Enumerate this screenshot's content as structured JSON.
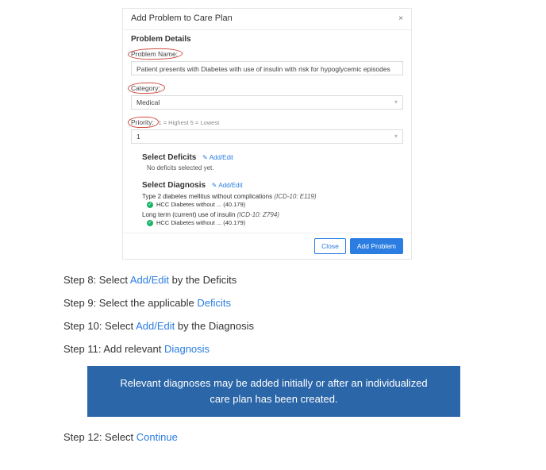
{
  "modal": {
    "title": "Add Problem to Care Plan",
    "problem_details_heading": "Problem Details",
    "problem_name_label": "Problem Name:",
    "problem_name_value": "Patient presents with Diabetes with use of insulin with risk for hypoglycemic episodes",
    "category_label": "Category:",
    "category_value": "Medical",
    "priority_label": "Priority:",
    "priority_hint": "1 = Highest 5 = Lowest",
    "priority_value": "1",
    "deficits_heading": "Select Deficits",
    "deficits_addedit": "Add/Edit",
    "deficits_text": "No deficits selected yet.",
    "diagnosis_heading": "Select Diagnosis",
    "diagnosis_addedit": "Add/Edit",
    "diag1_text": "Type 2 diabetes mellitus without complications ",
    "diag1_icd": "(ICD-10: E119)",
    "diag2_text": "Long term (current) use of insulin ",
    "diag2_icd": "(ICD-10: Z794)",
    "hcc_text": "HCC Diabetes without ... (40.179)",
    "check_glyph": "✓",
    "close_btn": "Close",
    "add_btn": "Add Problem",
    "close_x": "×"
  },
  "steps": {
    "s8a": "Step 8: Select ",
    "s8link": "Add/Edit",
    "s8b": " by the Deficits",
    "s9a": "Step 9: Select the applicable ",
    "s9link": "Deficits",
    "s10a": "Step 10: Select ",
    "s10link": "Add/Edit",
    "s10b": " by the Diagnosis",
    "s11a": "Step 11: Add relevant ",
    "s11link": "Diagnosis",
    "callout": "Relevant diagnoses may be added initially or after an individualized care plan has been created.",
    "s12a": "Step 12: Select ",
    "s12link": "Continue"
  }
}
